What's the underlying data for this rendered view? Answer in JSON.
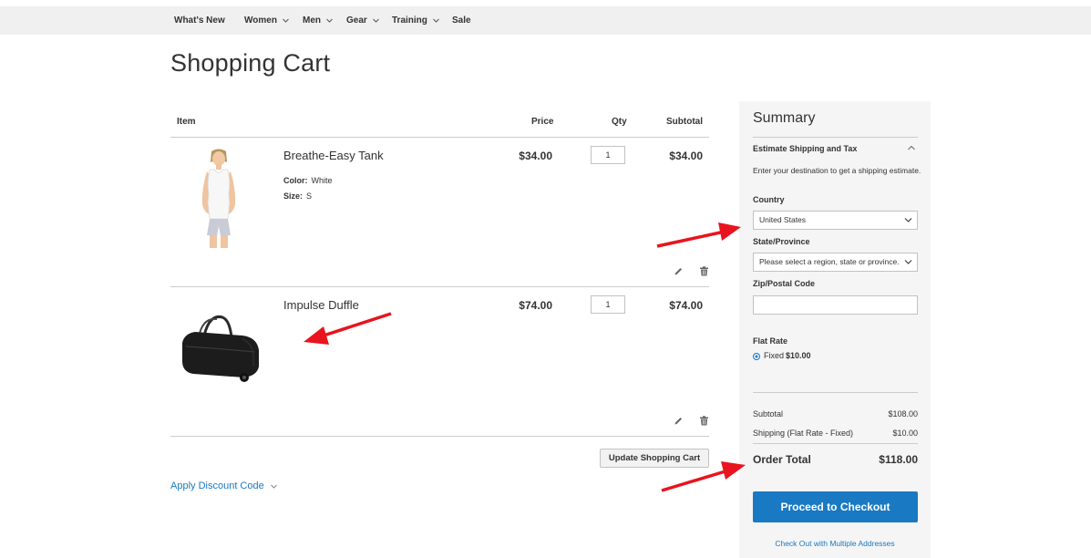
{
  "nav": {
    "items": [
      {
        "label": "What's New",
        "has_menu": false
      },
      {
        "label": "Women",
        "has_menu": true
      },
      {
        "label": "Men",
        "has_menu": true
      },
      {
        "label": "Gear",
        "has_menu": true
      },
      {
        "label": "Training",
        "has_menu": true
      },
      {
        "label": "Sale",
        "has_menu": false
      }
    ]
  },
  "page": {
    "title": "Shopping Cart"
  },
  "cart": {
    "headers": {
      "item": "Item",
      "price": "Price",
      "qty": "Qty",
      "subtotal": "Subtotal"
    },
    "items": [
      {
        "name": "Breathe-Easy Tank",
        "options": [
          {
            "label": "Color:",
            "value": "White"
          },
          {
            "label": "Size:",
            "value": "S"
          }
        ],
        "price": "$34.00",
        "qty": "1",
        "subtotal": "$34.00"
      },
      {
        "name": "Impulse Duffle",
        "options": [],
        "price": "$74.00",
        "qty": "1",
        "subtotal": "$74.00"
      }
    ],
    "update_label": "Update Shopping Cart",
    "discount_label": "Apply Discount Code"
  },
  "summary": {
    "title": "Summary",
    "estimate_title": "Estimate Shipping and Tax",
    "estimate_desc": "Enter your destination to get a shipping estimate.",
    "country_label": "Country",
    "country_value": "United States",
    "state_label": "State/Province",
    "state_value": "Please select a region, state or province.",
    "zip_label": "Zip/Postal Code",
    "zip_value": "",
    "flat_rate_title": "Flat Rate",
    "flat_rate_option": "Fixed",
    "flat_rate_price": "$10.00",
    "subtotal_label": "Subtotal",
    "subtotal_value": "$108.00",
    "shipping_label": "Shipping (Flat Rate - Fixed)",
    "shipping_value": "$10.00",
    "order_total_label": "Order Total",
    "order_total_value": "$118.00",
    "checkout_label": "Proceed to Checkout",
    "multi_address_label": "Check Out with Multiple Addresses"
  },
  "colors": {
    "link": "#1979c3",
    "button_primary": "#1979c3",
    "annotation_arrow": "#e8141e",
    "nav_bg": "#f0f0f0",
    "summary_bg": "#f5f5f5"
  }
}
